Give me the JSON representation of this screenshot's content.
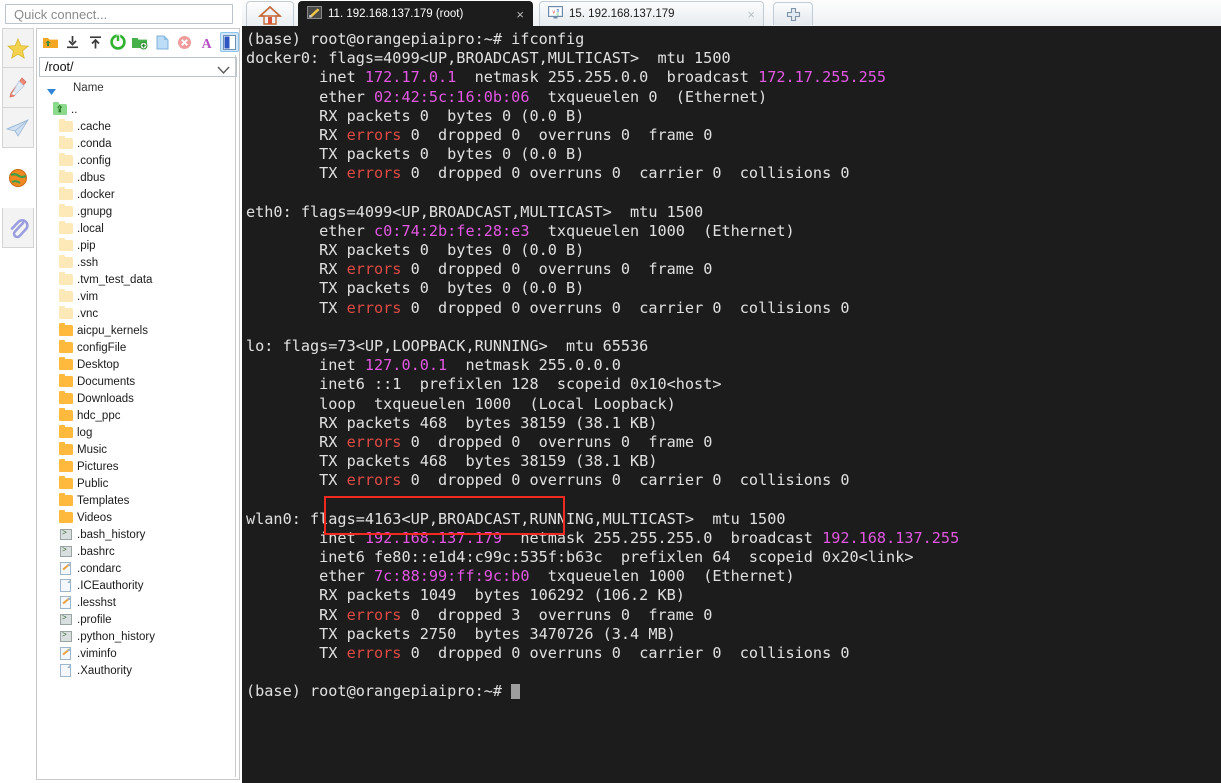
{
  "quick_connect": {
    "placeholder": "Quick connect..."
  },
  "icon_rail": [
    {
      "name": "favorites-icon",
      "glyph": "star"
    },
    {
      "name": "tools-icon",
      "glyph": "knife"
    },
    {
      "name": "send-icon",
      "glyph": "plane"
    },
    {
      "name": "globe-icon",
      "glyph": "globe"
    },
    {
      "name": "attach-icon",
      "glyph": "clip"
    }
  ],
  "file_browser": {
    "toolbar": [
      {
        "name": "parent-folder-button",
        "title": "Go to parent folder"
      },
      {
        "name": "download-button",
        "title": "Download"
      },
      {
        "name": "upload-button",
        "title": "Upload"
      },
      {
        "name": "refresh-button",
        "title": "Refresh"
      },
      {
        "name": "new-folder-button",
        "title": "New folder"
      },
      {
        "name": "new-file-button",
        "title": "New file"
      },
      {
        "name": "delete-button",
        "title": "Delete"
      },
      {
        "name": "text-edit-button",
        "title": "Text edit"
      },
      {
        "name": "toggle-panel-button",
        "title": "Follow terminal folder"
      }
    ],
    "path": "/root/",
    "column_header": "Name",
    "items": [
      {
        "label": "..",
        "type": "up"
      },
      {
        "label": ".cache",
        "type": "hidden-folder"
      },
      {
        "label": ".conda",
        "type": "hidden-folder"
      },
      {
        "label": ".config",
        "type": "hidden-folder"
      },
      {
        "label": ".dbus",
        "type": "hidden-folder"
      },
      {
        "label": ".docker",
        "type": "hidden-folder"
      },
      {
        "label": ".gnupg",
        "type": "hidden-folder"
      },
      {
        "label": ".local",
        "type": "hidden-folder"
      },
      {
        "label": ".pip",
        "type": "hidden-folder"
      },
      {
        "label": ".ssh",
        "type": "hidden-folder"
      },
      {
        "label": ".tvm_test_data",
        "type": "hidden-folder"
      },
      {
        "label": ".vim",
        "type": "hidden-folder"
      },
      {
        "label": ".vnc",
        "type": "hidden-folder"
      },
      {
        "label": "aicpu_kernels",
        "type": "folder"
      },
      {
        "label": "configFile",
        "type": "folder"
      },
      {
        "label": "Desktop",
        "type": "folder"
      },
      {
        "label": "Documents",
        "type": "folder"
      },
      {
        "label": "Downloads",
        "type": "folder"
      },
      {
        "label": "hdc_ppc",
        "type": "folder"
      },
      {
        "label": "log",
        "type": "folder"
      },
      {
        "label": "Music",
        "type": "folder"
      },
      {
        "label": "Pictures",
        "type": "folder"
      },
      {
        "label": "Public",
        "type": "folder"
      },
      {
        "label": "Templates",
        "type": "folder"
      },
      {
        "label": "Videos",
        "type": "folder"
      },
      {
        "label": ".bash_history",
        "type": "script"
      },
      {
        "label": ".bashrc",
        "type": "script"
      },
      {
        "label": ".condarc",
        "type": "editable"
      },
      {
        "label": ".ICEauthority",
        "type": "file"
      },
      {
        "label": ".lesshst",
        "type": "editable"
      },
      {
        "label": ".profile",
        "type": "script"
      },
      {
        "label": ".python_history",
        "type": "script"
      },
      {
        "label": ".viminfo",
        "type": "editable"
      },
      {
        "label": ".Xauthority",
        "type": "file"
      }
    ]
  },
  "tabs": {
    "home_label": "",
    "items": [
      {
        "label": "11. 192.168.137.179 (root)",
        "icon": "ssh-session-icon",
        "active": true,
        "close": "×"
      },
      {
        "label": "15. 192.168.137.179",
        "icon": "vnc-session-icon",
        "active": false,
        "close": "×"
      }
    ],
    "new_tab_label": "✛"
  },
  "terminal": {
    "prompt": "(base) root@orangepiaipro:~# ",
    "command": "ifconfig",
    "cursor": true,
    "colors": {
      "background": "#1c1c1c",
      "foreground": "#e0e0e0",
      "ip": "#e257e2",
      "error": "#e04a44",
      "highlight_box": "#f12a1f"
    },
    "lines": [
      [
        {
          "t": "(base) root@orangepiaipro:~# ifconfig"
        }
      ],
      [
        {
          "t": "docker0: flags=4099<UP,BROADCAST,MULTICAST>  mtu 1500"
        }
      ],
      [
        {
          "t": "        inet "
        },
        {
          "t": "172.17.0.1",
          "c": "ip"
        },
        {
          "t": "  netmask 255.255.0.0  broadcast "
        },
        {
          "t": "172.17.255.255",
          "c": "ip"
        }
      ],
      [
        {
          "t": "        ether "
        },
        {
          "t": "02:42:5c:16:0b:06",
          "c": "ip"
        },
        {
          "t": "  txqueuelen 0  (Ethernet)"
        }
      ],
      [
        {
          "t": "        RX packets 0  bytes 0 (0.0 B)"
        }
      ],
      [
        {
          "t": "        RX "
        },
        {
          "t": "errors",
          "c": "err"
        },
        {
          "t": " 0  dropped 0  overruns 0  frame 0"
        }
      ],
      [
        {
          "t": "        TX packets 0  bytes 0 (0.0 B)"
        }
      ],
      [
        {
          "t": "        TX "
        },
        {
          "t": "errors",
          "c": "err"
        },
        {
          "t": " 0  dropped 0 overruns 0  carrier 0  collisions 0"
        }
      ],
      [
        {
          "t": ""
        }
      ],
      [
        {
          "t": "eth0: flags=4099<UP,BROADCAST,MULTICAST>  mtu 1500"
        }
      ],
      [
        {
          "t": "        ether "
        },
        {
          "t": "c0:74:2b:fe:28:e3",
          "c": "ip"
        },
        {
          "t": "  txqueuelen 1000  (Ethernet)"
        }
      ],
      [
        {
          "t": "        RX packets 0  bytes 0 (0.0 B)"
        }
      ],
      [
        {
          "t": "        RX "
        },
        {
          "t": "errors",
          "c": "err"
        },
        {
          "t": " 0  dropped 0  overruns 0  frame 0"
        }
      ],
      [
        {
          "t": "        TX packets 0  bytes 0 (0.0 B)"
        }
      ],
      [
        {
          "t": "        TX "
        },
        {
          "t": "errors",
          "c": "err"
        },
        {
          "t": " 0  dropped 0 overruns 0  carrier 0  collisions 0"
        }
      ],
      [
        {
          "t": ""
        }
      ],
      [
        {
          "t": "lo: flags=73<UP,LOOPBACK,RUNNING>  mtu 65536"
        }
      ],
      [
        {
          "t": "        inet "
        },
        {
          "t": "127.0.0.1",
          "c": "ip"
        },
        {
          "t": "  netmask 255.0.0.0"
        }
      ],
      [
        {
          "t": "        inet6 ::1  prefixlen 128  scopeid 0x10<host>"
        }
      ],
      [
        {
          "t": "        loop  txqueuelen 1000  (Local Loopback)"
        }
      ],
      [
        {
          "t": "        RX packets 468  bytes 38159 (38.1 KB)"
        }
      ],
      [
        {
          "t": "        RX "
        },
        {
          "t": "errors",
          "c": "err"
        },
        {
          "t": " 0  dropped 0  overruns 0  frame 0"
        }
      ],
      [
        {
          "t": "        TX packets 468  bytes 38159 (38.1 KB)"
        }
      ],
      [
        {
          "t": "        TX "
        },
        {
          "t": "errors",
          "c": "err"
        },
        {
          "t": " 0  dropped 0 overruns 0  carrier 0  collisions 0"
        }
      ],
      [
        {
          "t": ""
        }
      ],
      [
        {
          "t": "wlan0: flags=4163<UP,BROADCAST,RUNNING,MULTICAST>  mtu 1500"
        }
      ],
      [
        {
          "t": "        inet "
        },
        {
          "t": "192.168.137.179",
          "c": "ip"
        },
        {
          "t": "  netmask 255.255.255.0  broadcast "
        },
        {
          "t": "192.168.137.255",
          "c": "ip"
        }
      ],
      [
        {
          "t": "        inet6 fe80::e1d4:c99c:535f:b63c  prefixlen 64  scopeid 0x20<link>"
        }
      ],
      [
        {
          "t": "        ether "
        },
        {
          "t": "7c:88:99:ff:9c:b0",
          "c": "ip"
        },
        {
          "t": "  txqueuelen 1000  (Ethernet)"
        }
      ],
      [
        {
          "t": "        RX packets 1049  bytes 106292 (106.2 KB)"
        }
      ],
      [
        {
          "t": "        RX "
        },
        {
          "t": "errors",
          "c": "err"
        },
        {
          "t": " 0  dropped 3  overruns 0  frame 0"
        }
      ],
      [
        {
          "t": "        TX packets 2750  bytes 3470726 (3.4 MB)"
        }
      ],
      [
        {
          "t": "        TX "
        },
        {
          "t": "errors",
          "c": "err"
        },
        {
          "t": " 0  dropped 0 overruns 0  carrier 0  collisions 0"
        }
      ],
      [
        {
          "t": ""
        }
      ],
      [
        {
          "t": "(base) root@orangepiaipro:~# ",
          "cur": true
        }
      ]
    ]
  }
}
